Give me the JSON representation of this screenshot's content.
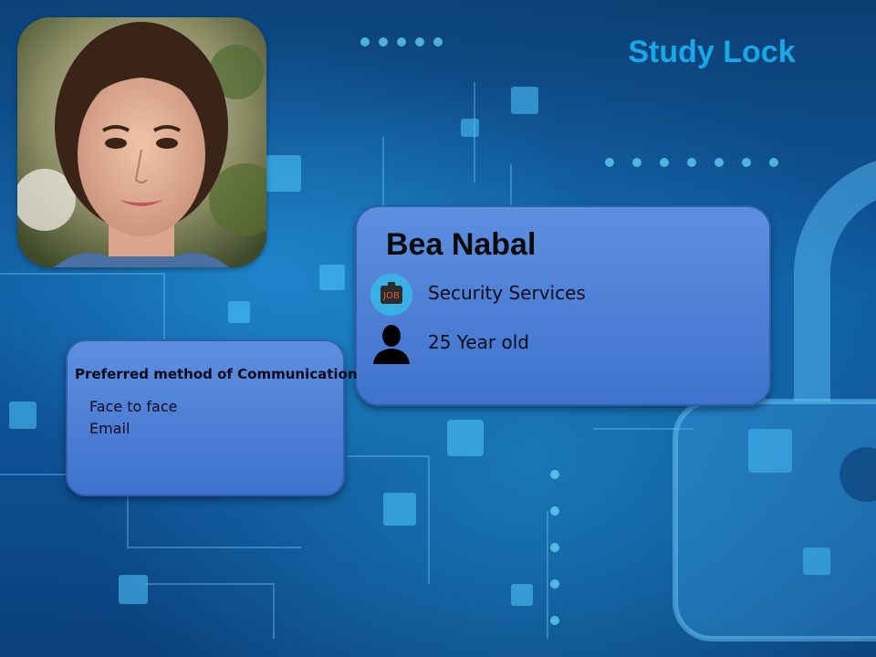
{
  "title": "Study Lock",
  "persona": {
    "name": "Bea Nabal",
    "occupation": "Security Services",
    "age": "25  Year old",
    "job_icon_text": "JOB"
  },
  "communication": {
    "heading": "Preferred method of Communication",
    "methods": [
      "Face to face",
      "Email"
    ]
  },
  "colors": {
    "title": "#1aa7e8",
    "card": "#4a7fd6"
  },
  "icons": [
    "job-icon",
    "person-icon",
    "padlock-icon"
  ]
}
